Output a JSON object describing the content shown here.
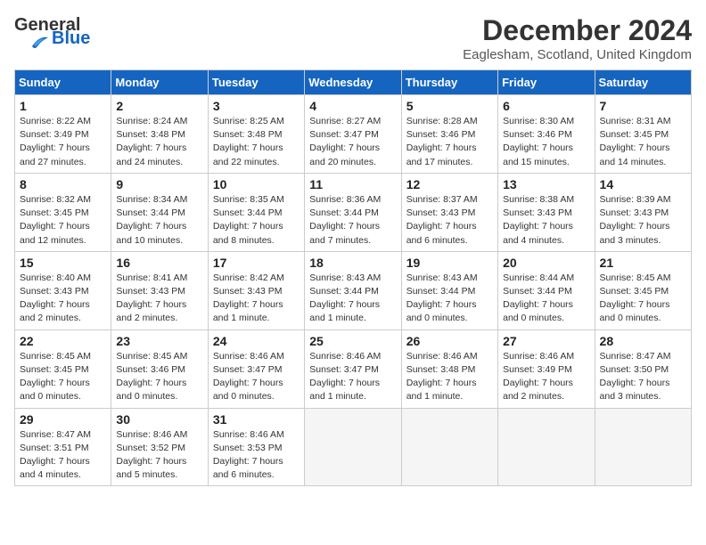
{
  "logo": {
    "line1": "General",
    "line2": "Blue"
  },
  "title": "December 2024",
  "location": "Eaglesham, Scotland, United Kingdom",
  "days_of_week": [
    "Sunday",
    "Monday",
    "Tuesday",
    "Wednesday",
    "Thursday",
    "Friday",
    "Saturday"
  ],
  "weeks": [
    [
      {
        "day": "1",
        "sunrise": "8:22 AM",
        "sunset": "3:49 PM",
        "daylight": "7 hours and 27 minutes."
      },
      {
        "day": "2",
        "sunrise": "8:24 AM",
        "sunset": "3:48 PM",
        "daylight": "7 hours and 24 minutes."
      },
      {
        "day": "3",
        "sunrise": "8:25 AM",
        "sunset": "3:48 PM",
        "daylight": "7 hours and 22 minutes."
      },
      {
        "day": "4",
        "sunrise": "8:27 AM",
        "sunset": "3:47 PM",
        "daylight": "7 hours and 20 minutes."
      },
      {
        "day": "5",
        "sunrise": "8:28 AM",
        "sunset": "3:46 PM",
        "daylight": "7 hours and 17 minutes."
      },
      {
        "day": "6",
        "sunrise": "8:30 AM",
        "sunset": "3:46 PM",
        "daylight": "7 hours and 15 minutes."
      },
      {
        "day": "7",
        "sunrise": "8:31 AM",
        "sunset": "3:45 PM",
        "daylight": "7 hours and 14 minutes."
      }
    ],
    [
      {
        "day": "8",
        "sunrise": "8:32 AM",
        "sunset": "3:45 PM",
        "daylight": "7 hours and 12 minutes."
      },
      {
        "day": "9",
        "sunrise": "8:34 AM",
        "sunset": "3:44 PM",
        "daylight": "7 hours and 10 minutes."
      },
      {
        "day": "10",
        "sunrise": "8:35 AM",
        "sunset": "3:44 PM",
        "daylight": "7 hours and 8 minutes."
      },
      {
        "day": "11",
        "sunrise": "8:36 AM",
        "sunset": "3:44 PM",
        "daylight": "7 hours and 7 minutes."
      },
      {
        "day": "12",
        "sunrise": "8:37 AM",
        "sunset": "3:43 PM",
        "daylight": "7 hours and 6 minutes."
      },
      {
        "day": "13",
        "sunrise": "8:38 AM",
        "sunset": "3:43 PM",
        "daylight": "7 hours and 4 minutes."
      },
      {
        "day": "14",
        "sunrise": "8:39 AM",
        "sunset": "3:43 PM",
        "daylight": "7 hours and 3 minutes."
      }
    ],
    [
      {
        "day": "15",
        "sunrise": "8:40 AM",
        "sunset": "3:43 PM",
        "daylight": "7 hours and 2 minutes."
      },
      {
        "day": "16",
        "sunrise": "8:41 AM",
        "sunset": "3:43 PM",
        "daylight": "7 hours and 2 minutes."
      },
      {
        "day": "17",
        "sunrise": "8:42 AM",
        "sunset": "3:43 PM",
        "daylight": "7 hours and 1 minute."
      },
      {
        "day": "18",
        "sunrise": "8:43 AM",
        "sunset": "3:44 PM",
        "daylight": "7 hours and 1 minute."
      },
      {
        "day": "19",
        "sunrise": "8:43 AM",
        "sunset": "3:44 PM",
        "daylight": "7 hours and 0 minutes."
      },
      {
        "day": "20",
        "sunrise": "8:44 AM",
        "sunset": "3:44 PM",
        "daylight": "7 hours and 0 minutes."
      },
      {
        "day": "21",
        "sunrise": "8:45 AM",
        "sunset": "3:45 PM",
        "daylight": "7 hours and 0 minutes."
      }
    ],
    [
      {
        "day": "22",
        "sunrise": "8:45 AM",
        "sunset": "3:45 PM",
        "daylight": "7 hours and 0 minutes."
      },
      {
        "day": "23",
        "sunrise": "8:45 AM",
        "sunset": "3:46 PM",
        "daylight": "7 hours and 0 minutes."
      },
      {
        "day": "24",
        "sunrise": "8:46 AM",
        "sunset": "3:47 PM",
        "daylight": "7 hours and 0 minutes."
      },
      {
        "day": "25",
        "sunrise": "8:46 AM",
        "sunset": "3:47 PM",
        "daylight": "7 hours and 1 minute."
      },
      {
        "day": "26",
        "sunrise": "8:46 AM",
        "sunset": "3:48 PM",
        "daylight": "7 hours and 1 minute."
      },
      {
        "day": "27",
        "sunrise": "8:46 AM",
        "sunset": "3:49 PM",
        "daylight": "7 hours and 2 minutes."
      },
      {
        "day": "28",
        "sunrise": "8:47 AM",
        "sunset": "3:50 PM",
        "daylight": "7 hours and 3 minutes."
      }
    ],
    [
      {
        "day": "29",
        "sunrise": "8:47 AM",
        "sunset": "3:51 PM",
        "daylight": "7 hours and 4 minutes."
      },
      {
        "day": "30",
        "sunrise": "8:46 AM",
        "sunset": "3:52 PM",
        "daylight": "7 hours and 5 minutes."
      },
      {
        "day": "31",
        "sunrise": "8:46 AM",
        "sunset": "3:53 PM",
        "daylight": "7 hours and 6 minutes."
      },
      null,
      null,
      null,
      null
    ]
  ],
  "labels": {
    "sunrise": "Sunrise:",
    "sunset": "Sunset:",
    "daylight": "Daylight:"
  }
}
